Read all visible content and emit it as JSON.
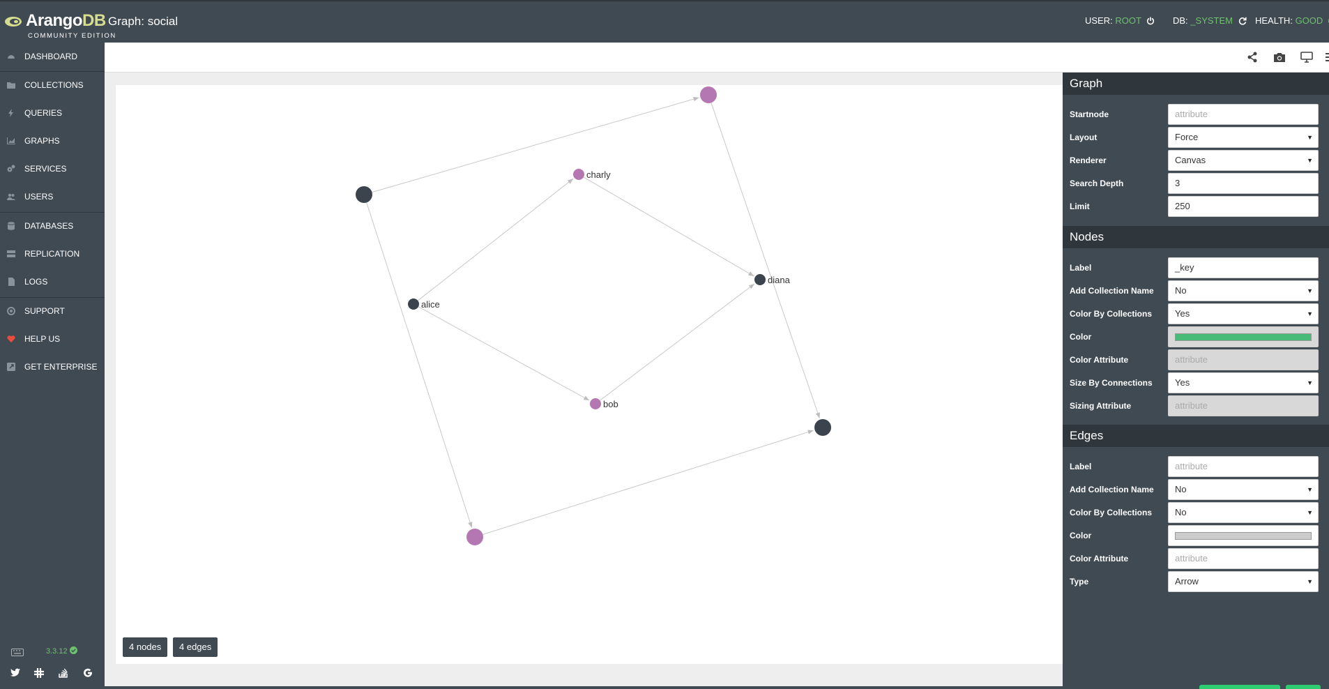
{
  "brand": {
    "name_main": "Arango",
    "name_accent": "DB",
    "edition": "COMMUNITY EDITION"
  },
  "page_title": "Graph: social",
  "status": {
    "user_label": "USER:",
    "user_value": "ROOT",
    "db_label": "DB:",
    "db_value": "_SYSTEM",
    "health_label": "HEALTH:",
    "health_value": "GOOD"
  },
  "sidebar": {
    "items": [
      {
        "label": "DASHBOARD",
        "icon": "dashboard-icon"
      },
      {
        "label": "COLLECTIONS",
        "icon": "folder-icon"
      },
      {
        "label": "QUERIES",
        "icon": "bolt-icon"
      },
      {
        "label": "GRAPHS",
        "icon": "area-chart-icon"
      },
      {
        "label": "SERVICES",
        "icon": "cogs-icon"
      },
      {
        "label": "USERS",
        "icon": "users-icon"
      },
      {
        "label": "DATABASES",
        "icon": "database-icon"
      },
      {
        "label": "REPLICATION",
        "icon": "server-icon"
      },
      {
        "label": "LOGS",
        "icon": "file-icon"
      },
      {
        "label": "SUPPORT",
        "icon": "life-ring-icon"
      },
      {
        "label": "HELP US",
        "icon": "heart-icon"
      },
      {
        "label": "GET ENTERPRISE",
        "icon": "external-link-icon"
      }
    ],
    "version": "3.3.12",
    "social_icons": [
      "twitter-icon",
      "slack-icon",
      "stack-overflow-icon",
      "google-icon"
    ]
  },
  "colors": {
    "chrome": "#404a53",
    "chrome_dark": "#2f363c",
    "accent_green": "#6fc16f",
    "node_dark": "#3b444c",
    "node_purple": "#b577b2",
    "edge": "#c8c8c8",
    "heart": "#e74c3c",
    "node_color_swatch": "#48bb78",
    "edge_color_swatch": "#cccccc"
  },
  "graph": {
    "nodes": [
      {
        "id": "n1",
        "label": "",
        "color": "dark"
      },
      {
        "id": "n2",
        "label": "",
        "color": "purple"
      },
      {
        "id": "n3",
        "label": "charly",
        "color": "purple"
      },
      {
        "id": "n4",
        "label": "alice",
        "color": "dark"
      },
      {
        "id": "n5",
        "label": "diana",
        "color": "dark"
      },
      {
        "id": "n6",
        "label": "bob",
        "color": "purple"
      },
      {
        "id": "n7",
        "label": "",
        "color": "dark"
      },
      {
        "id": "n8",
        "label": "",
        "color": "purple"
      }
    ],
    "edges": [
      [
        "n1",
        "n2"
      ],
      [
        "n2",
        "n7"
      ],
      [
        "n8",
        "n7"
      ],
      [
        "n1",
        "n8"
      ],
      [
        "n4",
        "n3"
      ],
      [
        "n3",
        "n5"
      ],
      [
        "n4",
        "n6"
      ],
      [
        "n6",
        "n5"
      ]
    ],
    "node_count": "4 nodes",
    "edge_count": "4 edges"
  },
  "toolbar_icons": [
    "share-icon",
    "camera-icon",
    "desktop-icon",
    "menu-icon"
  ],
  "panel": {
    "graph": {
      "title": "Graph",
      "startnode": {
        "label": "Startnode",
        "value": "",
        "placeholder": "attribute"
      },
      "layout": {
        "label": "Layout",
        "value": "Force"
      },
      "renderer": {
        "label": "Renderer",
        "value": "Canvas"
      },
      "depth": {
        "label": "Search Depth",
        "value": "3"
      },
      "limit": {
        "label": "Limit",
        "value": "250"
      }
    },
    "nodes": {
      "title": "Nodes",
      "label": {
        "label": "Label",
        "value": "_key"
      },
      "add_coll": {
        "label": "Add Collection Name",
        "value": "No"
      },
      "color_by": {
        "label": "Color By Collections",
        "value": "Yes"
      },
      "color": {
        "label": "Color"
      },
      "color_attr": {
        "label": "Color Attribute",
        "placeholder": "attribute"
      },
      "size_by": {
        "label": "Size By Connections",
        "value": "Yes"
      },
      "size_attr": {
        "label": "Sizing Attribute",
        "placeholder": "attribute"
      }
    },
    "edges": {
      "title": "Edges",
      "label": {
        "label": "Label",
        "placeholder": "attribute"
      },
      "add_coll": {
        "label": "Add Collection Name",
        "value": "No"
      },
      "color_by": {
        "label": "Color By Collections",
        "value": "No"
      },
      "color": {
        "label": "Color"
      },
      "color_attr": {
        "label": "Color Attribute",
        "placeholder": "attribute"
      },
      "type": {
        "label": "Type",
        "value": "Arrow"
      }
    }
  }
}
